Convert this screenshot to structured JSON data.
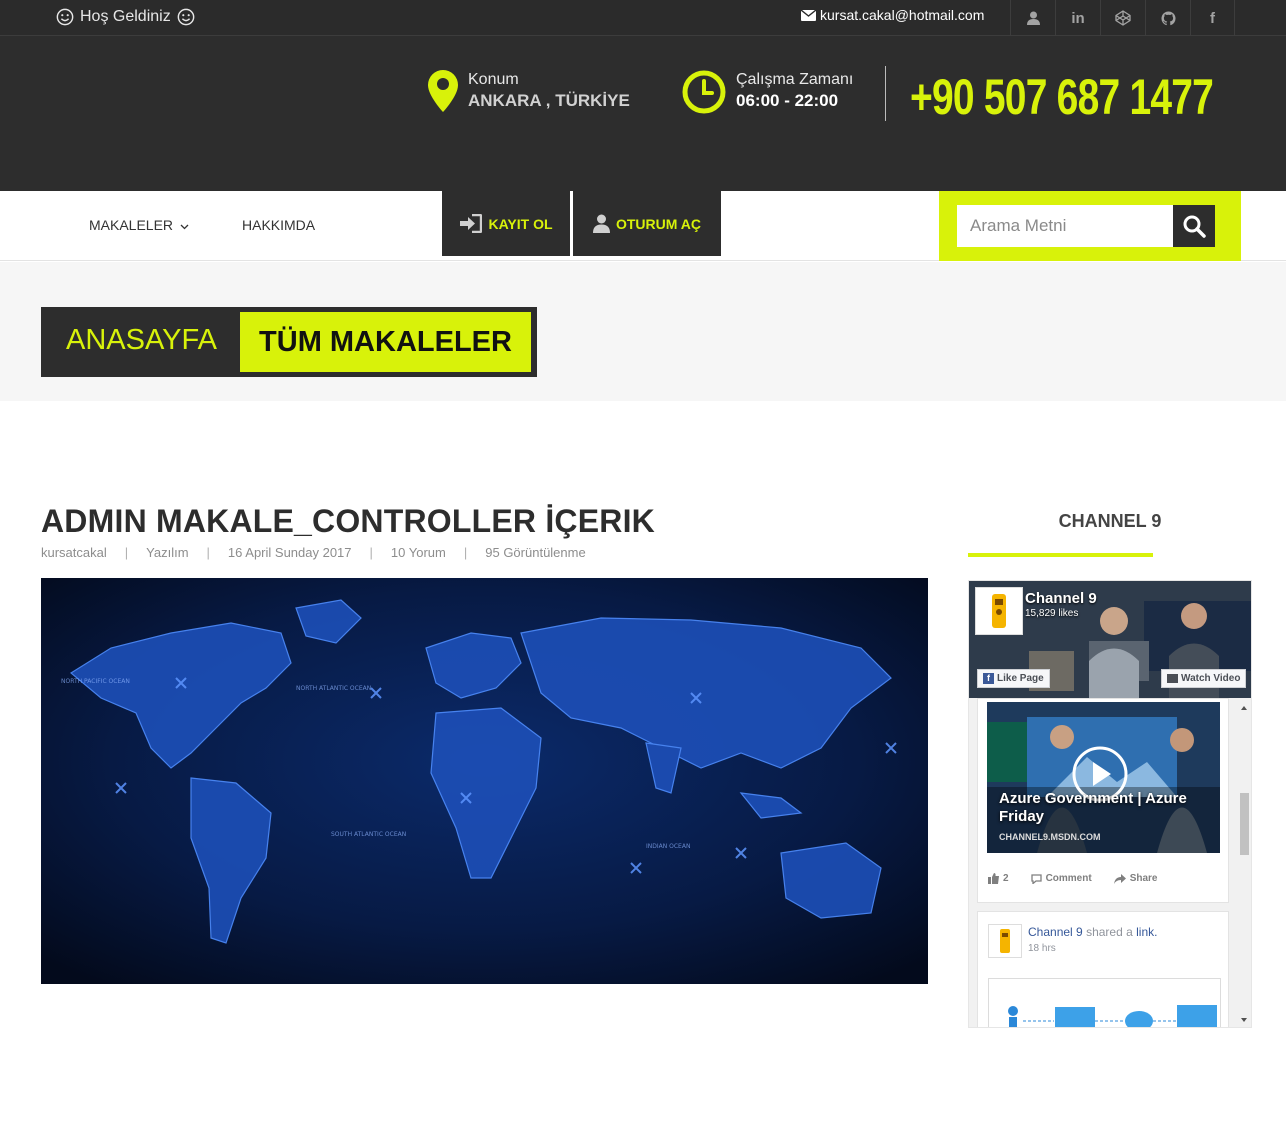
{
  "topbar": {
    "welcome": "Hoş Geldiniz",
    "email": "kursat.cakal@hotmail.com",
    "social_icons": [
      "user-icon",
      "linkedin-icon",
      "codepen-icon",
      "github-icon",
      "facebook-icon"
    ]
  },
  "header": {
    "location_label": "Konum",
    "location_value": "ANKARA , TÜRKİYE",
    "hours_label": "Çalışma Zamanı",
    "hours_value": "06:00 - 22:00",
    "phone": "+90 507 687 1477"
  },
  "nav": {
    "items": [
      {
        "label": "MAKALELER"
      },
      {
        "label": "HAKKIMDA"
      }
    ],
    "register": "KAYIT OL",
    "login": "OTURUM AÇ",
    "search_placeholder": "Arama Metni"
  },
  "breadcrumb": {
    "home": "ANASAYFA",
    "current": "TÜM MAKALELER"
  },
  "article": {
    "title": "ADMIN MAKALE_CONTROLLER İÇERIK",
    "author": "kursatcakal",
    "category": "Yazılım",
    "date": "16 April Sunday 2017",
    "comments": "10 Yorum",
    "views": "95 Görüntülenme"
  },
  "sidebar": {
    "widget_title": "CHANNEL 9",
    "fb": {
      "page_name": "Channel 9",
      "likes": "15,829 likes",
      "like_page": "Like Page",
      "watch_video": "Watch Video",
      "video_title": "Azure Government | Azure Friday",
      "video_site": "CHANNEL9.MSDN.COM",
      "like_count": "2",
      "comment": "Comment",
      "share": "Share",
      "post2_page": "Channel 9",
      "post2_text": "shared a",
      "post2_link": "link.",
      "post2_time": "18 hrs"
    }
  },
  "colors": {
    "accent": "#d8f20a",
    "dark": "#2d2d2d"
  }
}
